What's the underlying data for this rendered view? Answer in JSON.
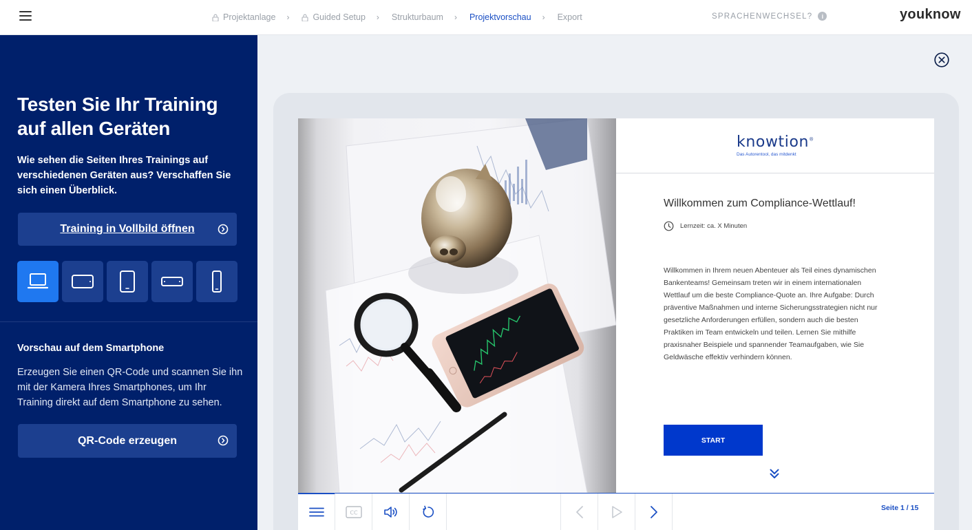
{
  "topbar": {
    "steps": [
      {
        "label": "Projektanlage",
        "locked": true
      },
      {
        "label": "Guided Setup",
        "locked": true
      },
      {
        "label": "Strukturbaum",
        "locked": false
      },
      {
        "label": "Projektvorschau",
        "locked": false,
        "active": true
      },
      {
        "label": "Export",
        "locked": false
      }
    ],
    "language_switch": "SPRACHENWECHSEL?",
    "info_glyph": "i",
    "brand": "youknow"
  },
  "sidebar": {
    "title": "Testen Sie Ihr Training auf allen Geräten",
    "intro": "Wie sehen die Seiten Ihres Trainings auf verschiedenen Geräten aus? Verschaffen Sie sich einen Überblick.",
    "fullscreen_button": "Training in Vollbild öffnen",
    "devices": [
      "laptop-icon",
      "tablet-landscape-icon",
      "tablet-portrait-icon",
      "phone-landscape-icon",
      "phone-portrait-icon"
    ],
    "active_device": "laptop-icon",
    "smartphone_heading": "Vorschau auf dem Smartphone",
    "smartphone_text": "Erzeugen Sie einen QR-Code und scannen Sie ihn mit der Kamera Ihres Smartphones, um Ihr Training direkt auf dem Smartphone zu sehen.",
    "qr_button": "QR-Code erzeugen"
  },
  "preview": {
    "logo_word": "knowtion",
    "logo_mark": "®",
    "logo_tagline": "Das Autorentool, das mitdenkt",
    "heading": "Willkommen zum Compliance-Wettlauf!",
    "learning_time": "Lernzeit: ca. X Minuten",
    "body": "Willkommen in Ihrem neuen Abenteuer als Teil eines dynamischen Bankenteams! Gemeinsam treten wir in einem internationalen Wettlauf um die beste Compliance-Quote an. Ihre Aufgabe: Durch präventive Maßnahmen und interne Sicherungsstrategien nicht nur gesetzliche Anforderungen erfüllen, sondern auch die besten Praktiken im Team entwickeln und teilen. Lernen Sie mithilfe praxisnaher Beispiele und spannender Teamaufgaben, wie Sie Geldwäsche effektiv verhindern können.",
    "start_button": "START",
    "cc_label": "CC",
    "page_indicator": "Seite 1 / 15"
  },
  "colors": {
    "sidebar_bg": "#00206b",
    "sidebar_button": "#1c3f8f",
    "active_device": "#1f78f0",
    "accent": "#1a4fc4",
    "start_button": "#0038cc"
  }
}
